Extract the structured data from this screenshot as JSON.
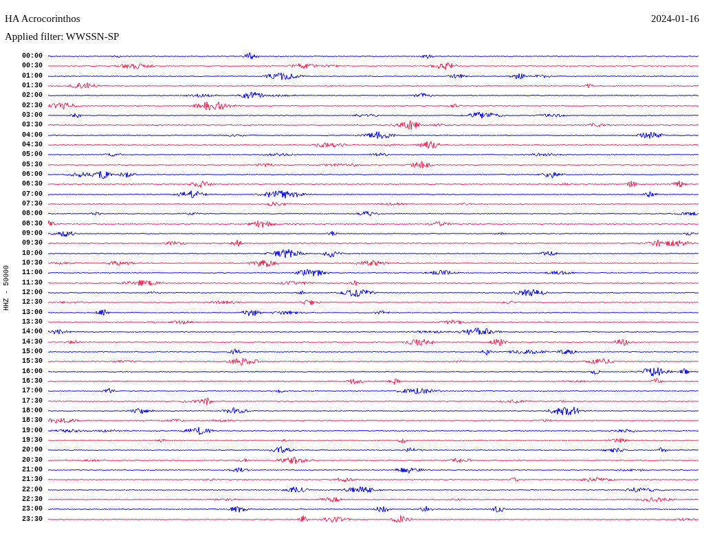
{
  "header": {
    "station": "HA Acrocorinthos",
    "date": "2024-01-16",
    "filter": "Applied filter: WWSSN-SP"
  },
  "axis_label": "HHZ - 50000",
  "rows": [
    {
      "time": "00:00",
      "color": "#0000ff"
    },
    {
      "time": "00:30",
      "color": "#ff1a4d"
    },
    {
      "time": "01:00",
      "color": "#0000ff"
    },
    {
      "time": "01:30",
      "color": "#ff1a4d"
    },
    {
      "time": "02:00",
      "color": "#0000ff"
    },
    {
      "time": "02:30",
      "color": "#ff1a4d"
    },
    {
      "time": "03:00",
      "color": "#0000ff"
    },
    {
      "time": "03:30",
      "color": "#ff1a4d"
    },
    {
      "time": "04:00",
      "color": "#0000ff"
    },
    {
      "time": "04:30",
      "color": "#ff1a4d"
    },
    {
      "time": "05:00",
      "color": "#0000ff"
    },
    {
      "time": "05:30",
      "color": "#ff1a4d"
    },
    {
      "time": "06:00",
      "color": "#0000ff"
    },
    {
      "time": "06:30",
      "color": "#ff1a4d"
    },
    {
      "time": "07:00",
      "color": "#0000ff"
    },
    {
      "time": "07:30",
      "color": "#ff1a4d"
    },
    {
      "time": "08:00",
      "color": "#0000ff"
    },
    {
      "time": "08:30",
      "color": "#ff1a4d"
    },
    {
      "time": "09:00",
      "color": "#0000ff"
    },
    {
      "time": "09:30",
      "color": "#ff1a4d"
    },
    {
      "time": "10:00",
      "color": "#0000ff"
    },
    {
      "time": "10:30",
      "color": "#ff1a4d"
    },
    {
      "time": "11:00",
      "color": "#0000ff"
    },
    {
      "time": "11:30",
      "color": "#ff1a4d"
    },
    {
      "time": "12:00",
      "color": "#0000ff"
    },
    {
      "time": "12:30",
      "color": "#ff1a4d"
    },
    {
      "time": "13:00",
      "color": "#0000ff"
    },
    {
      "time": "13:30",
      "color": "#ff1a4d"
    },
    {
      "time": "14:00",
      "color": "#0000ff"
    },
    {
      "time": "14:30",
      "color": "#ff1a4d"
    },
    {
      "time": "15:00",
      "color": "#0000ff"
    },
    {
      "time": "15:30",
      "color": "#ff1a4d"
    },
    {
      "time": "16:00",
      "color": "#0000ff"
    },
    {
      "time": "16:30",
      "color": "#ff1a4d"
    },
    {
      "time": "17:00",
      "color": "#0000ff"
    },
    {
      "time": "17:30",
      "color": "#ff1a4d"
    },
    {
      "time": "18:00",
      "color": "#0000ff"
    },
    {
      "time": "18:30",
      "color": "#ff1a4d"
    },
    {
      "time": "19:00",
      "color": "#0000ff"
    },
    {
      "time": "19:30",
      "color": "#ff1a4d"
    },
    {
      "time": "20:00",
      "color": "#0000ff"
    },
    {
      "time": "20:30",
      "color": "#ff1a4d"
    },
    {
      "time": "21:00",
      "color": "#0000ff"
    },
    {
      "time": "21:30",
      "color": "#ff1a4d"
    },
    {
      "time": "22:00",
      "color": "#0000ff"
    },
    {
      "time": "22:30",
      "color": "#ff1a4d"
    },
    {
      "time": "23:00",
      "color": "#0000ff"
    },
    {
      "time": "23:30",
      "color": "#ff1a4d"
    }
  ]
}
